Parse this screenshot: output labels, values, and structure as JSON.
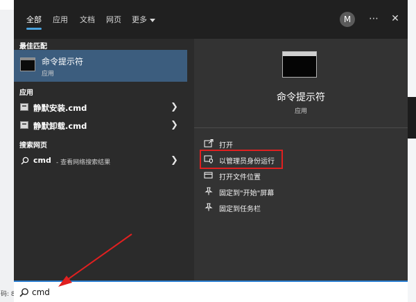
{
  "tabs": [
    {
      "label": "全部",
      "active": true
    },
    {
      "label": "应用",
      "active": false
    },
    {
      "label": "文档",
      "active": false
    },
    {
      "label": "网页",
      "active": false
    },
    {
      "label": "更多",
      "active": false
    }
  ],
  "user": {
    "avatar_letter": "M"
  },
  "icons": {
    "more": "ellipsis-icon",
    "close": "close-icon",
    "search": "search-icon"
  },
  "best_match": {
    "heading": "最佳匹配",
    "title": "命令提示符",
    "subtitle": "应用"
  },
  "apps": {
    "heading": "应用",
    "items": [
      {
        "label": "静默安装.cmd"
      },
      {
        "label": "静默卸载.cmd"
      }
    ]
  },
  "web": {
    "heading": "搜索网页",
    "query": "cmd",
    "description": "- 查看网络搜索结果"
  },
  "detail": {
    "title": "命令提示符",
    "subtitle": "应用",
    "actions": [
      {
        "label": "打开",
        "icon": "open-icon"
      },
      {
        "label": "以管理员身份运行",
        "icon": "admin-shield-icon",
        "highlighted": true
      },
      {
        "label": "打开文件位置",
        "icon": "file-location-icon"
      },
      {
        "label": "固定到\"开始\"屏幕",
        "icon": "pin-icon"
      },
      {
        "label": "固定到任务栏",
        "icon": "pin-icon"
      }
    ]
  },
  "search": {
    "value": "cmd"
  },
  "background": {
    "footer_fragment": "码: 8"
  },
  "colors": {
    "accent": "#4aa3df",
    "selection": "#3c5d7e",
    "highlight": "#e02020"
  }
}
